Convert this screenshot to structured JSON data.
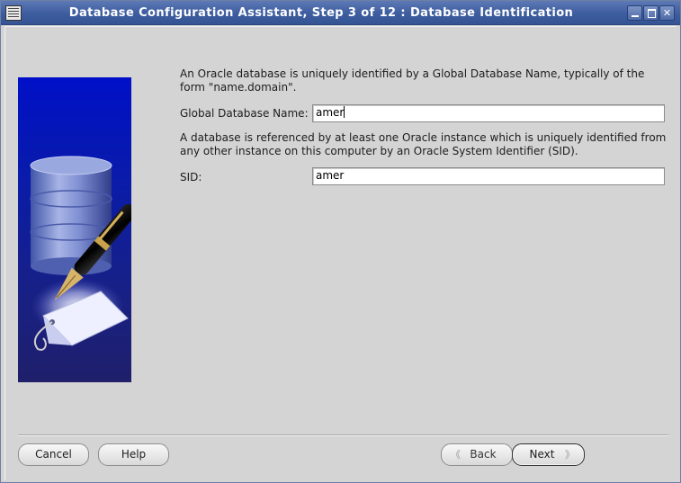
{
  "window": {
    "title": "Database Configuration Assistant, Step 3 of 12 : Database Identification"
  },
  "content": {
    "intro_text": "An Oracle database is uniquely identified by a Global Database Name, typically of the form \"name.domain\".",
    "global_db_name": {
      "label": "Global Database Name:",
      "value": "amer"
    },
    "sid_description": "A database is referenced by at least one Oracle instance which is uniquely identified from any other instance on this computer by an Oracle System Identifier (SID).",
    "sid": {
      "label": "SID:",
      "value": "amer"
    }
  },
  "buttons": {
    "cancel": "Cancel",
    "help": "Help",
    "back": "Back",
    "next": "Next"
  },
  "icons": {
    "app": "app-menu-icon",
    "minimize": "minimize-icon",
    "maximize": "maximize-icon",
    "close": "close-icon",
    "back": "chevron-left-icon",
    "next": "chevron-right-icon",
    "illustration": "database-pen-illustration"
  },
  "colors": {
    "titlebar": "#3d5d9f",
    "background": "#d4d4d4",
    "art_top": "#0010c8",
    "art_bottom": "#1f1f6a"
  }
}
